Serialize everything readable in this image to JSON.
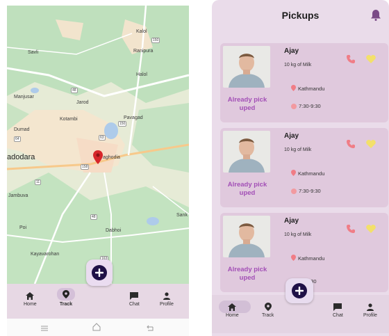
{
  "map_screen": {
    "places": {
      "kalol": "Kalol",
      "savli": "Savli",
      "ranipura": "Ranipura",
      "halol": "Halol",
      "manjusar": "Manjusar",
      "jarod": "Jarod",
      "kotambi": "Kotambi",
      "pavagad": "Pavagad",
      "dumad": "Dumad",
      "vadodara": "adodara",
      "waghodia": "aghodia",
      "jambuva": "Jambuva",
      "poi": "Poi",
      "dabhoi": "Dabhoi",
      "kayavarohan": "Kayavarohan",
      "sank": "Sank"
    },
    "shields": {
      "r1": "150",
      "r2": "48",
      "r3": "64",
      "r4": "158",
      "r5": "63",
      "r6": "11",
      "r7": "48",
      "r8": "150",
      "r9": "163"
    },
    "nav": {
      "home": "Home",
      "track": "Track",
      "chat": "Chat",
      "profile": "Profile"
    }
  },
  "pickups_screen": {
    "title": "Pickups",
    "cards": [
      {
        "name": "Ajay",
        "quantity": "10 kg of Milk",
        "location": "Kathmandu",
        "time": "7:30-9:30",
        "status": "Already pick uped"
      },
      {
        "name": "Ajay",
        "quantity": "10 kg of Milk",
        "location": "Kathmandu",
        "time": "7:30-9:30",
        "status": "Already pick uped"
      },
      {
        "name": "Ajay",
        "quantity": "10 kg of Milk",
        "location": "Kathmandu",
        "time": "9:30",
        "status": "Already pick uped"
      }
    ],
    "nav": {
      "home": "Home",
      "track": "Track",
      "chat": "Chat",
      "profile": "Profile"
    }
  },
  "colors": {
    "accent": "#a24fb6",
    "fab": "#1f1147",
    "card": "#e0c9dd",
    "background": "#eadcea"
  }
}
